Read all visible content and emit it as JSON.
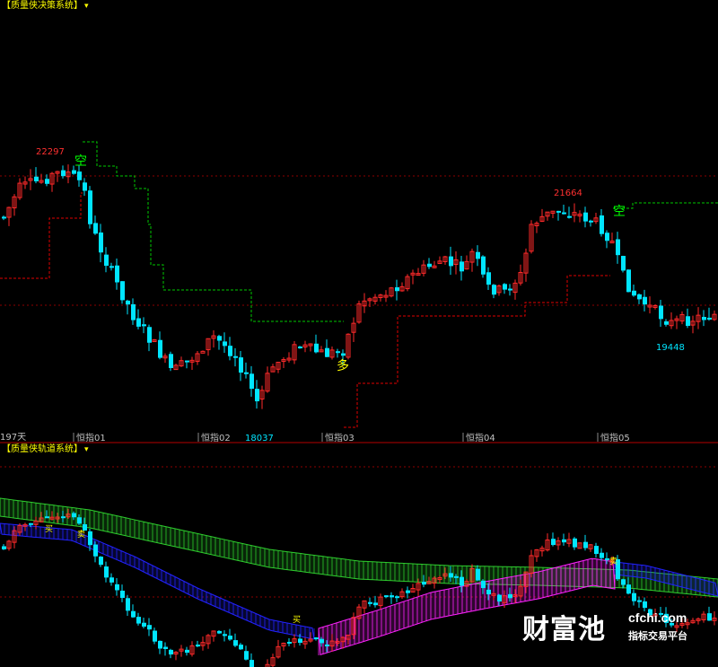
{
  "panels": {
    "top": {
      "title": "【质量侠决策系统】",
      "arrow": "▾"
    },
    "bottom": {
      "title": "【质量侠轨道系统】",
      "arrow": "▾"
    }
  },
  "axis": {
    "period_label": "197天",
    "month_labels": [
      "恒指01",
      "恒指02",
      "恒指03",
      "恒指04",
      "恒指05"
    ]
  },
  "annotations": {
    "high1": "22297",
    "high2": "21664",
    "low1": "18037",
    "low2": "19448",
    "short_signal": "空",
    "long_signal": "多",
    "buy_signal": "买",
    "sell_signal": "卖"
  },
  "colors": {
    "up": "#ff2a2a",
    "down": "#00e5ff",
    "short_stop": "#00c800",
    "long_stop": "#e00000",
    "ribbon_green": "#2ecc2e",
    "ribbon_blue": "#2222ff",
    "ribbon_magenta": "#ff22ff",
    "ribbon_red": "#c81e1e",
    "title": "#ffff00",
    "separator": "#b40000"
  },
  "watermark": {
    "brand": "财富池",
    "site": "cfchi.com",
    "slogan": "指标交易平台"
  }
}
